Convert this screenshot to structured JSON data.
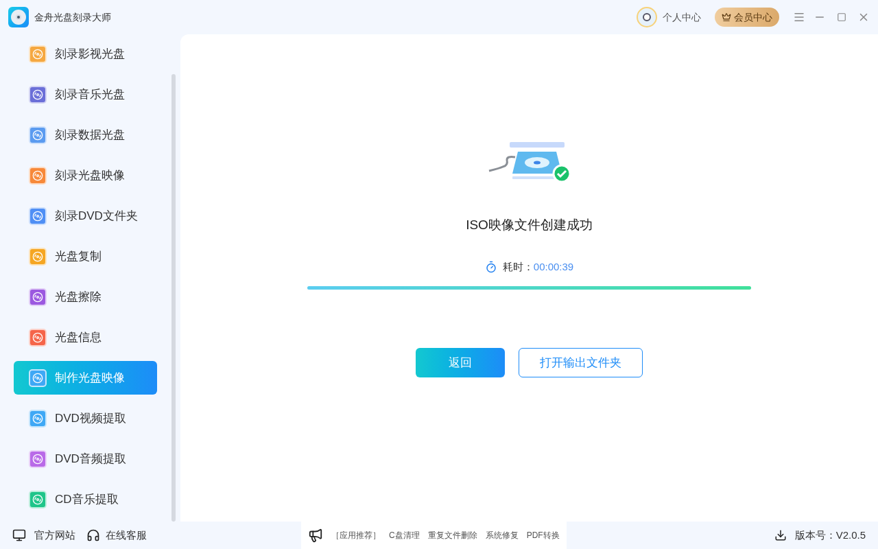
{
  "app": {
    "title": "金舟光盘刻录大师"
  },
  "header": {
    "user": "个人中心",
    "vip": "会员中心"
  },
  "sidebar": {
    "items": [
      {
        "label": "刻录影视光盘",
        "color": "#f5a841",
        "selected": false
      },
      {
        "label": "刻录音乐光盘",
        "color": "#6b6fd8",
        "selected": false
      },
      {
        "label": "刻录数据光盘",
        "color": "#5b9bf0",
        "selected": false
      },
      {
        "label": "刻录光盘映像",
        "color": "#f7893a",
        "selected": false
      },
      {
        "label": "刻录DVD文件夹",
        "color": "#4f8ff5",
        "selected": false
      },
      {
        "label": "光盘复制",
        "color": "#f5a623",
        "selected": false
      },
      {
        "label": "光盘擦除",
        "color": "#9b59e0",
        "selected": false
      },
      {
        "label": "光盘信息",
        "color": "#f5654a",
        "selected": false
      },
      {
        "label": "制作光盘映像",
        "color": "#3fa8f5",
        "selected": true
      },
      {
        "label": "DVD视频提取",
        "color": "#3fa8f5",
        "selected": false
      },
      {
        "label": "DVD音频提取",
        "color": "#b96ae8",
        "selected": false
      },
      {
        "label": "CD音乐提取",
        "color": "#1fc58a",
        "selected": false
      }
    ]
  },
  "result": {
    "message": "ISO映像文件创建成功",
    "elapsed_label": "耗时：",
    "elapsed": "00:00:39",
    "level": 1,
    "buttons": [
      {
        "label": "返回",
        "kind": "primary"
      },
      {
        "label": "打开输出文件夹",
        "kind": "outline"
      }
    ]
  },
  "footer": {
    "links": [
      "官方网站",
      "在线客服"
    ],
    "recommend": {
      "label": "［应用推荐］",
      "items": [
        "C盘清理",
        "重复文件删除",
        "系统修复",
        "PDF转换"
      ]
    },
    "version": "版本号：V2.0.5"
  }
}
